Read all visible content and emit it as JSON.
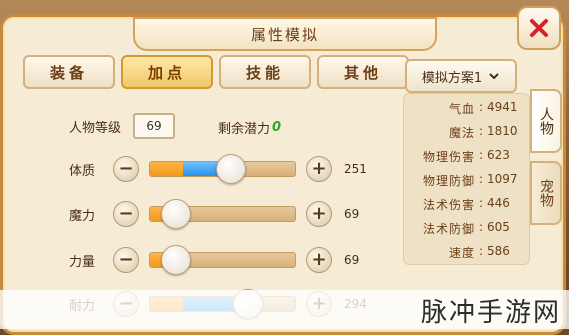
{
  "window": {
    "title": "属性模拟"
  },
  "tabs": [
    {
      "label": "装备"
    },
    {
      "label": "加点",
      "active": true
    },
    {
      "label": "技能"
    },
    {
      "label": "其他"
    }
  ],
  "scheme": {
    "label": "模拟方案1"
  },
  "side_tabs": [
    {
      "label": "人物",
      "active": true
    },
    {
      "label": "宠物"
    }
  ],
  "level": {
    "label": "人物等级",
    "value": "69"
  },
  "remaining": {
    "label": "剩余潜力",
    "value": "0"
  },
  "attributes": [
    {
      "label": "体质",
      "value": "251",
      "base_fraction": 0.23,
      "extra_fraction": 0.23,
      "knob_fraction": 0.55
    },
    {
      "label": "魔力",
      "value": "69",
      "base_fraction": 0.1,
      "extra_fraction": 0,
      "knob_fraction": 0.17
    },
    {
      "label": "力量",
      "value": "69",
      "base_fraction": 0.1,
      "extra_fraction": 0,
      "knob_fraction": 0.17
    },
    {
      "label": "耐力",
      "value": "294",
      "base_fraction": 0.23,
      "extra_fraction": 0.44,
      "knob_fraction": 0.67
    }
  ],
  "stats": [
    {
      "label": "气血",
      "sep": ":",
      "value": "4941"
    },
    {
      "label": "魔法",
      "sep": ":",
      "value": "1810"
    },
    {
      "label": "物理伤害",
      "sep": ":",
      "value": "623"
    },
    {
      "label": "物理防御",
      "sep": ":",
      "value": "1097"
    },
    {
      "label": "法术伤害",
      "sep": ":",
      "value": "446"
    },
    {
      "label": "法术防御",
      "sep": ":",
      "value": "605"
    },
    {
      "label": "速度",
      "sep": ":",
      "value": "586"
    }
  ],
  "watermark": "脉冲手游网",
  "colors": {
    "accent": "#f0c769",
    "extra_points": "#2a8fe6",
    "base_points": "#f29a1d",
    "remaining": "#2da82d"
  }
}
